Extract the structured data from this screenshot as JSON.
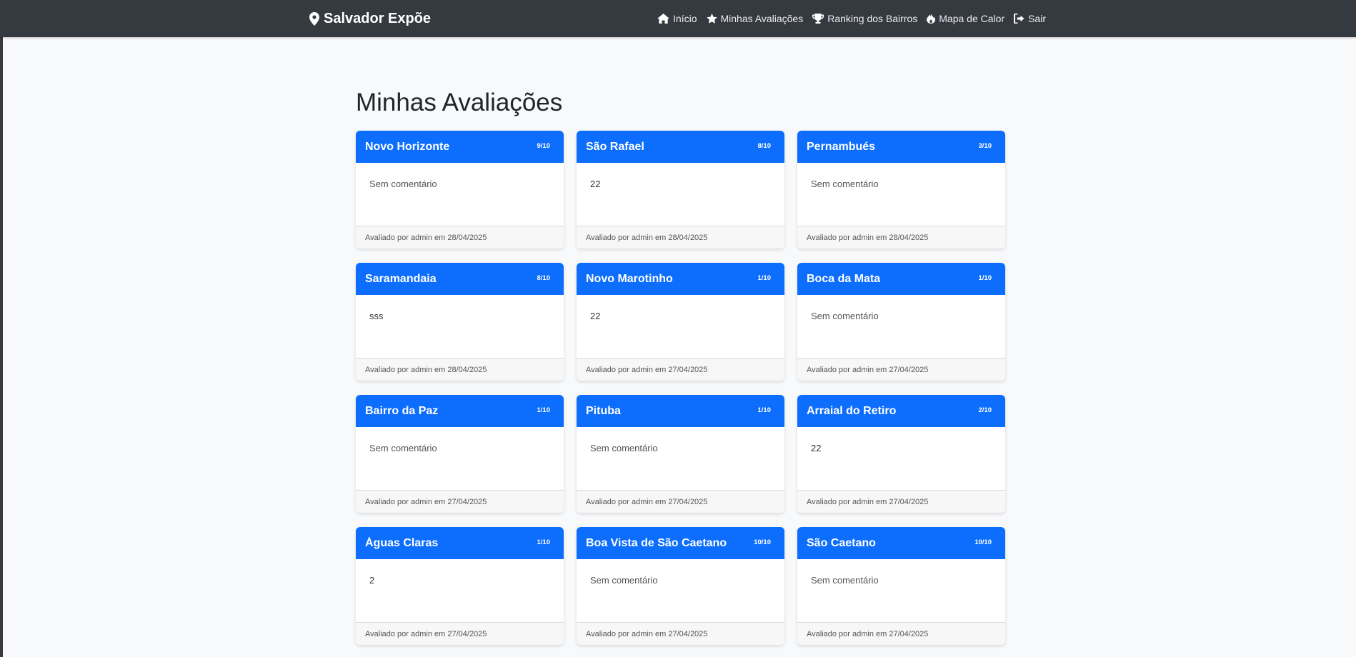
{
  "navbar": {
    "brand": "Salvador Expõe",
    "brand_icon": "map-marker-icon",
    "links": [
      {
        "label": "Início",
        "icon": "home-icon"
      },
      {
        "label": "Minhas Avaliações",
        "icon": "star-icon"
      },
      {
        "label": "Ranking dos Bairros",
        "icon": "trophy-icon"
      },
      {
        "label": "Mapa de Calor",
        "icon": "fire-icon"
      },
      {
        "label": "Sair",
        "icon": "sign-out-icon"
      }
    ]
  },
  "page": {
    "title": "Minhas Avaliações"
  },
  "colors": {
    "navbar": "#343a40",
    "card_header": "#0d6efd",
    "background": "#f8f9fa"
  },
  "reviews": [
    {
      "neighborhood": "Novo Horizonte",
      "score": "9/10",
      "comment": "Sem comentário",
      "footer": "Avaliado por admin em 28/04/2025"
    },
    {
      "neighborhood": "São Rafael",
      "score": "8/10",
      "comment": "22",
      "footer": "Avaliado por admin em 28/04/2025"
    },
    {
      "neighborhood": "Pernambués",
      "score": "3/10",
      "comment": "Sem comentário",
      "footer": "Avaliado por admin em 28/04/2025"
    },
    {
      "neighborhood": "Saramandaia",
      "score": "8/10",
      "comment": "sss",
      "footer": "Avaliado por admin em 28/04/2025"
    },
    {
      "neighborhood": "Novo Marotinho",
      "score": "1/10",
      "comment": "22",
      "footer": "Avaliado por admin em 27/04/2025"
    },
    {
      "neighborhood": "Boca da Mata",
      "score": "1/10",
      "comment": "Sem comentário",
      "footer": "Avaliado por admin em 27/04/2025"
    },
    {
      "neighborhood": "Bairro da Paz",
      "score": "1/10",
      "comment": "Sem comentário",
      "footer": "Avaliado por admin em 27/04/2025"
    },
    {
      "neighborhood": "Pituba",
      "score": "1/10",
      "comment": "Sem comentário",
      "footer": "Avaliado por admin em 27/04/2025"
    },
    {
      "neighborhood": "Arraial do Retiro",
      "score": "2/10",
      "comment": "22",
      "footer": "Avaliado por admin em 27/04/2025"
    },
    {
      "neighborhood": "Águas Claras",
      "score": "1/10",
      "comment": "2",
      "footer": "Avaliado por admin em 27/04/2025"
    },
    {
      "neighborhood": "Boa Vista de São Caetano",
      "score": "10/10",
      "comment": "Sem comentário",
      "footer": "Avaliado por admin em 27/04/2025"
    },
    {
      "neighborhood": "São Caetano",
      "score": "10/10",
      "comment": "Sem comentário",
      "footer": "Avaliado por admin em 27/04/2025"
    }
  ]
}
